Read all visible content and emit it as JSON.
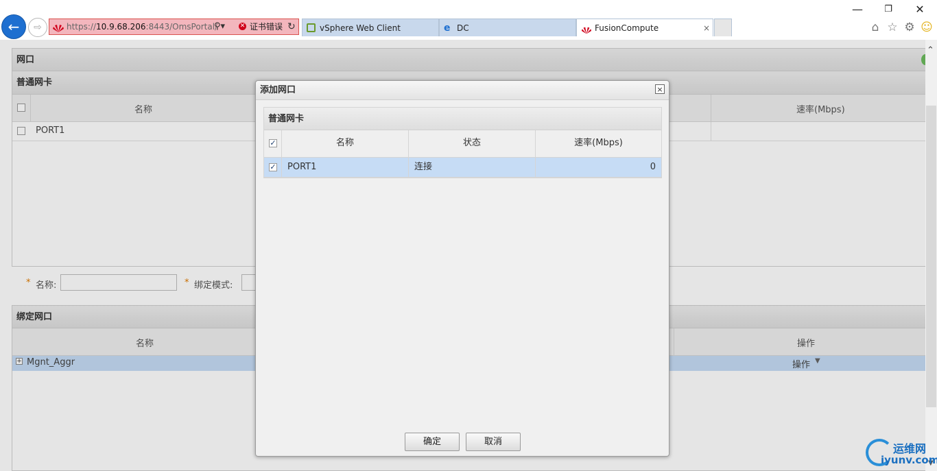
{
  "browser": {
    "address_prefix": "https://",
    "address_host": "10.9.68.206",
    "address_rest": ":8443/OmsPortal/",
    "cert_error": "证书错误",
    "tabs": [
      {
        "label": "vSphere Web Client",
        "active": false
      },
      {
        "label": "DC",
        "active": false
      },
      {
        "label": "FusionCompute",
        "active": true
      }
    ],
    "tab_close": "×"
  },
  "page": {
    "section_title": "网口",
    "nic_table": {
      "title": "普通网卡",
      "columns": [
        "名称",
        "速率(Mbps)"
      ],
      "rows": [
        {
          "name": "PORT1"
        }
      ]
    },
    "form": {
      "required_mark": "*",
      "name_label": "名称:",
      "bind_mode_label": "绑定模式:"
    },
    "bond_table": {
      "title": "绑定网口",
      "columns": [
        "名称",
        "操作"
      ],
      "rows": [
        {
          "expander": "+",
          "name": "Mgnt_Aggr",
          "action": "操作"
        }
      ]
    }
  },
  "dialog": {
    "title": "添加网口",
    "close": "×",
    "table": {
      "title": "普通网卡",
      "columns": [
        "名称",
        "状态",
        "速率(Mbps)"
      ],
      "header_checked": true,
      "rows": [
        {
          "checked": true,
          "name": "PORT1",
          "status": "连接",
          "speed": "0"
        }
      ]
    },
    "buttons": {
      "ok": "确定",
      "cancel": "取消"
    }
  },
  "watermark": {
    "cn": "运维网",
    "url": "iyunv.com"
  },
  "colors": {
    "accent": "#1e6fd0",
    "selected_row": "#c6dcf5",
    "cert_error_bg": "#f3b6bd"
  }
}
